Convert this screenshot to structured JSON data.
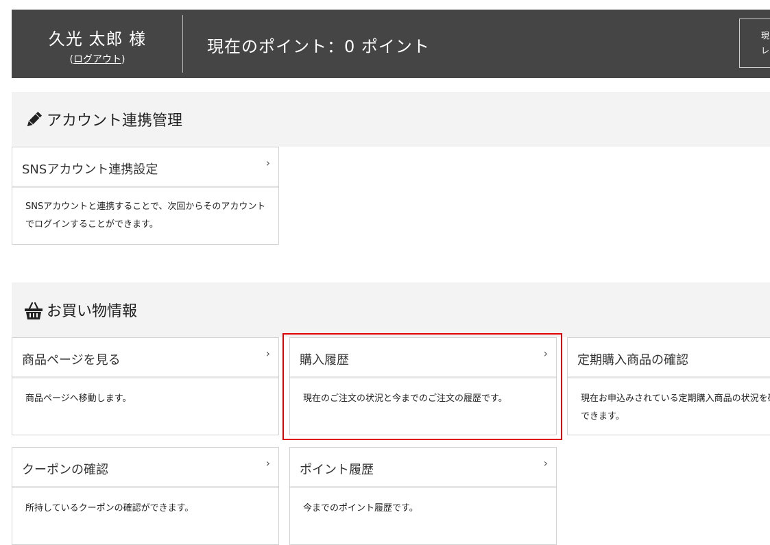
{
  "header": {
    "user_name": "久光 太郎 様",
    "logout_label": "ログアウト",
    "points_text": "現在のポイント：0 ポイント",
    "side_button_line1": "現",
    "side_button_line2": "レギ"
  },
  "sections": [
    {
      "title": "アカウント連携管理",
      "icon": "pencil-icon",
      "cards": [
        {
          "title": "SNSアカウント連携設定",
          "desc": "SNSアカウントと連携することで、次回からそのアカウントでログインすることができます。"
        }
      ]
    },
    {
      "title": "お買い物情報",
      "icon": "shopping-basket-icon",
      "cards": [
        {
          "title": "商品ページを見る",
          "desc": "商品ページへ移動します。"
        },
        {
          "title": "購入履歴",
          "desc": "現在のご注文の状況と今までのご注文の履歴です。"
        },
        {
          "title": "定期購入商品の確認",
          "desc": "現在お申込みされている定期購入商品の状況を確認することができます。"
        },
        {
          "title": "クーポンの確認",
          "desc": "所持しているクーポンの確認ができます。"
        },
        {
          "title": "ポイント履歴",
          "desc": "今までのポイント履歴です。"
        }
      ]
    }
  ],
  "chevron_glyph": "›",
  "colors": {
    "header_bg": "#454545",
    "section_bg": "#f3f3f3",
    "highlight": "#e00000"
  }
}
